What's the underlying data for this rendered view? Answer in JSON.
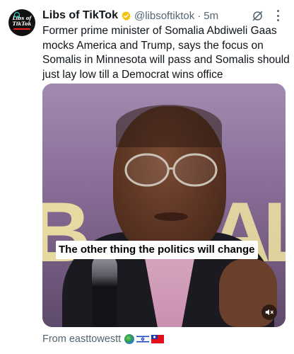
{
  "author": {
    "name": "Libs of TikTok",
    "handle": "@libsoftiktok",
    "separator": "·",
    "time": "5m",
    "avatar_logo_text": "Libs of TikTok"
  },
  "post": {
    "text": "Former prime minister of Somalia Abdiweli Gaas mocks America and Trump, says the focus on Somalis in Minnesota will pass and Somalis should just lay low till a Democrat wins office"
  },
  "media": {
    "caption": "The other thing the politics will change",
    "muted": true
  },
  "attribution": {
    "source_text": "From easttowestt",
    "emoji": [
      "globe-icon",
      "israel-flag-icon",
      "taiwan-flag-icon"
    ]
  },
  "colors": {
    "text_primary": "#0f1419",
    "text_secondary": "#536471",
    "verified_badge": "#f4c20d"
  }
}
